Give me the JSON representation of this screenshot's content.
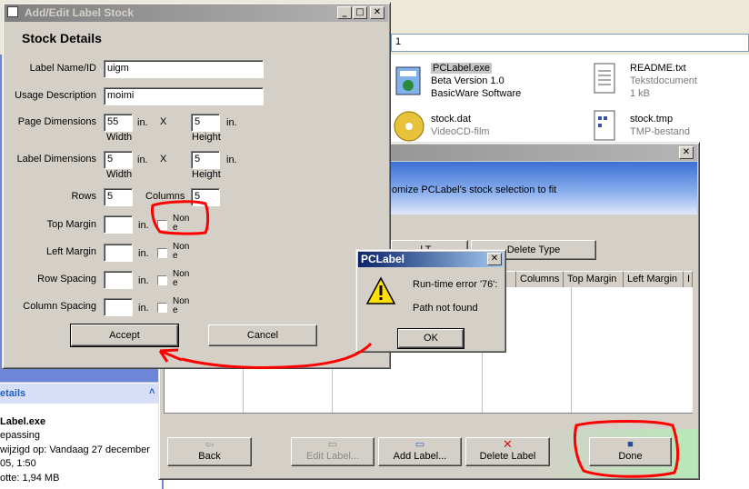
{
  "explorer": {
    "address": "1",
    "files": [
      {
        "name": "PCLabel.exe",
        "line2": "Beta Version 1.0",
        "line3": "BasicWare Software"
      },
      {
        "name": "README.txt",
        "line2": "Tekstdocument",
        "line3": "1 kB"
      },
      {
        "name": "stock.dat",
        "line2": "VideoCD-film",
        "line3": ""
      },
      {
        "name": "stock.tmp",
        "line2": "TMP-bestand",
        "line3": ""
      }
    ],
    "details": {
      "title": "etails",
      "chevron": "˄",
      "name": "Label.exe",
      "line1": "epassing",
      "line2": "wijzigd op: Vandaag 27 december",
      "line3": "05, 1:50",
      "line4": "otte: 1,94 MB"
    }
  },
  "manager": {
    "banner_text": "omize PCLabel's stock selection to fit",
    "close_glyph": "✕",
    "top_buttons": [
      "l T...",
      "Delete Type"
    ],
    "columns": [
      "s",
      "Columns",
      "Top Margin",
      "Left Margin",
      "I"
    ],
    "bottom_buttons": {
      "back": "Back",
      "edit": "Edit Label...",
      "add": "Add Label...",
      "delete": "Delete Label",
      "done": "Done"
    }
  },
  "dialog": {
    "title": "Add/Edit Label Stock",
    "heading": "Stock Details",
    "fields": {
      "label_name_label": "Label Name/ID",
      "label_name_value": "uigm",
      "usage_label": "Usage Description",
      "usage_value": "moimi",
      "page_dim_label": "Page Dimensions",
      "page_w": "55",
      "page_h": "5",
      "label_dim_label": "Label Dimensions",
      "label_w": "5",
      "label_h": "5",
      "rows_label": "Rows",
      "rows_value": "5",
      "columns_label": "Columns",
      "columns_value": "5",
      "top_margin_label": "Top Margin",
      "left_margin_label": "Left Margin",
      "row_spacing_label": "Row Spacing",
      "column_spacing_label": "Column Spacing"
    },
    "unit": "in.",
    "times": "X",
    "width_caption": "Width",
    "height_caption": "Height",
    "none_label_line1": "Non",
    "none_label_line2": "e",
    "accept": "Accept",
    "cancel": "Cancel"
  },
  "error": {
    "title": "PCLabel",
    "line1": "Run-time error '76':",
    "line2": "Path not found",
    "ok": "OK",
    "close_glyph": "✕"
  },
  "colors": {
    "annotation": "#ff0000",
    "active_title": "#0a246a",
    "inactive_title": "#808080"
  }
}
